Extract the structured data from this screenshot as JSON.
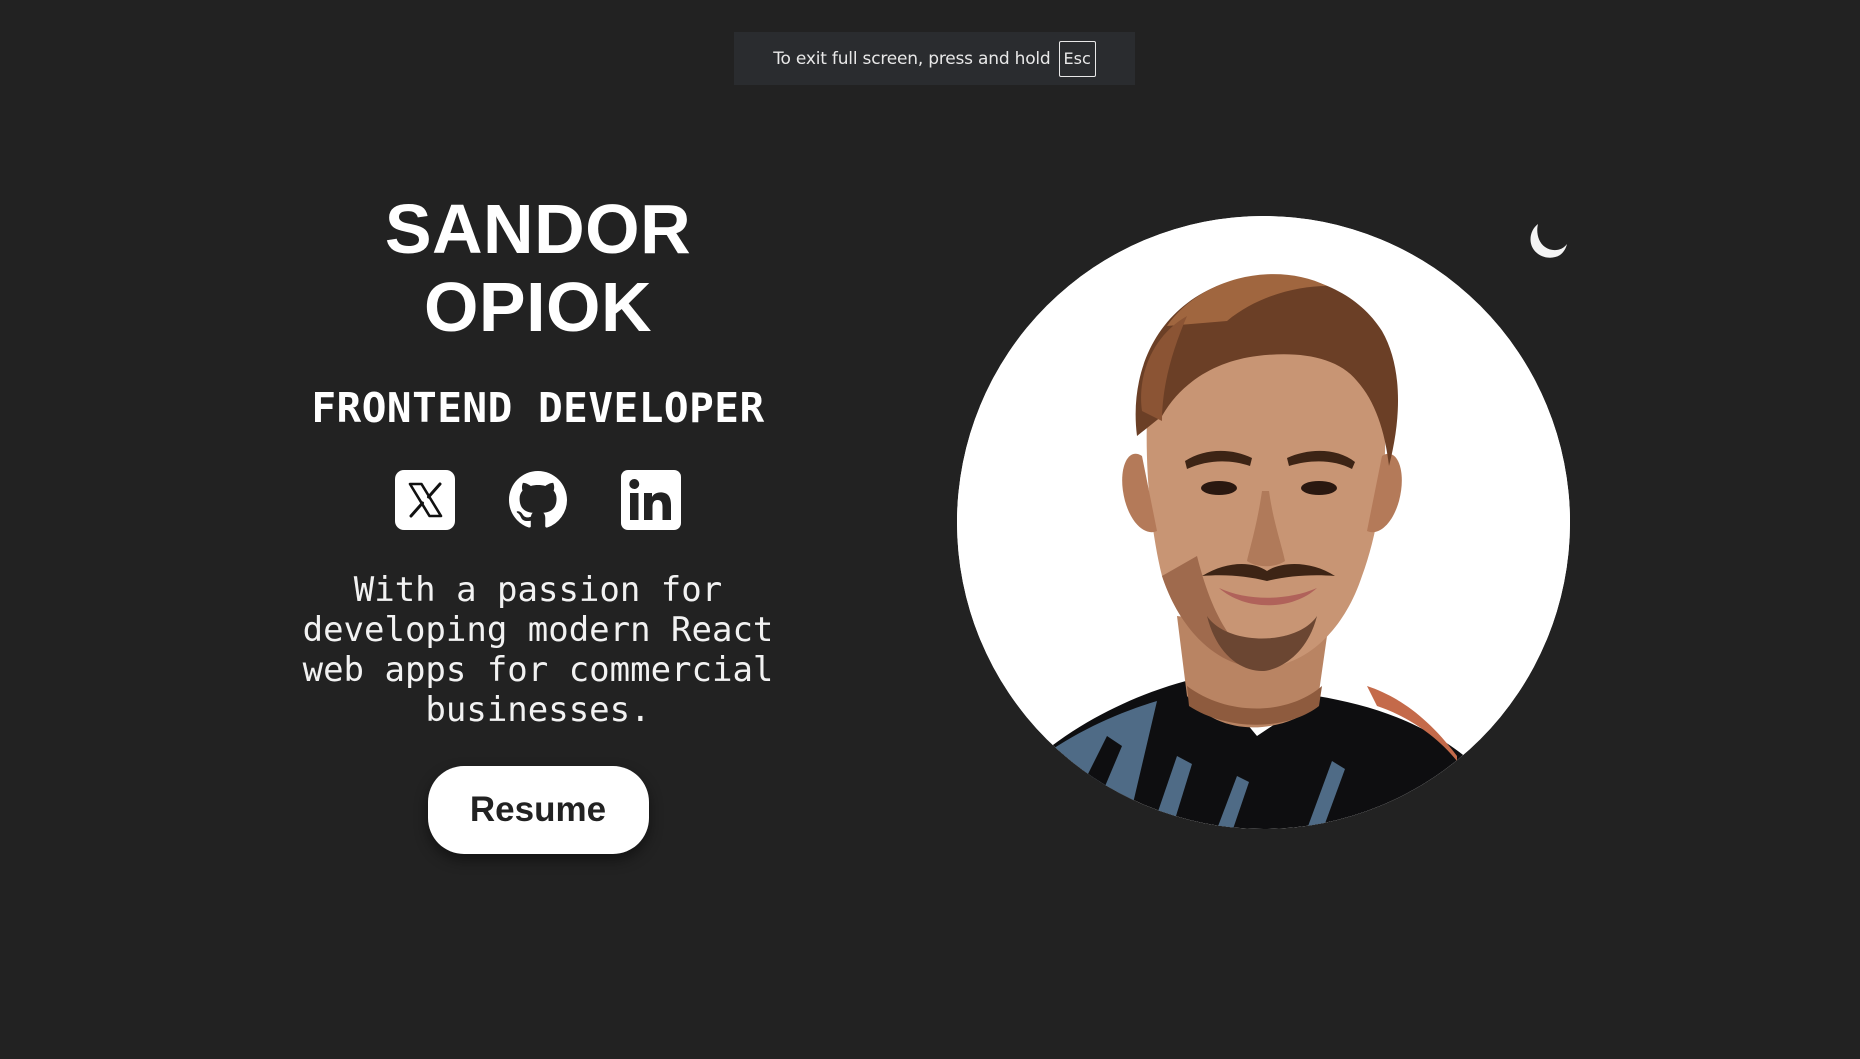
{
  "fullscreen_notice": {
    "message": "To exit full screen, press and hold",
    "key": "Esc"
  },
  "hero": {
    "name_line1": "SANDOR",
    "name_line2": "OPIOK",
    "role": "FRONTEND DEVELOPER",
    "tagline": "With a passion for developing modern React web apps for commercial businesses.",
    "resume_label": "Resume"
  },
  "socials": [
    {
      "icon": "x-twitter-icon"
    },
    {
      "icon": "github-icon"
    },
    {
      "icon": "linkedin-icon"
    }
  ],
  "portrait": {
    "icon": "avatar-illustration"
  },
  "theme_toggle": {
    "icon": "moon-icon"
  },
  "colors": {
    "background": "#222222",
    "text": "#ffffff",
    "button_bg": "#ffffff",
    "button_text": "#222222",
    "notice_bg": "#2a2c2f"
  }
}
